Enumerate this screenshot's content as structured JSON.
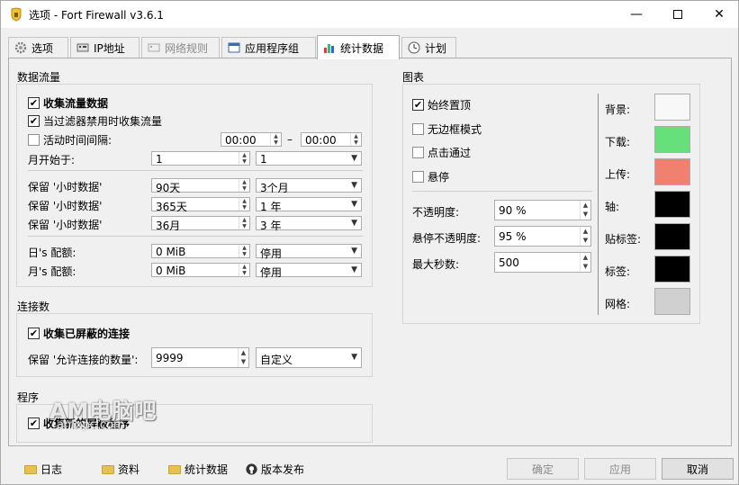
{
  "window": {
    "title": "选项 - Fort Firewall v3.6.1"
  },
  "tabs": [
    {
      "label": "选项",
      "icon": "gear-icon",
      "state": "normal"
    },
    {
      "label": "IP地址",
      "icon": "network-card-icon",
      "state": "normal"
    },
    {
      "label": "网络规则",
      "icon": "network-card-icon",
      "state": "disabled"
    },
    {
      "label": "应用程序组",
      "icon": "window-icon",
      "state": "normal"
    },
    {
      "label": "统计数据",
      "icon": "bar-chart-icon",
      "state": "active"
    },
    {
      "label": "计划",
      "icon": "clock-icon",
      "state": "normal"
    }
  ],
  "traffic": {
    "title": "数据流量",
    "collect": {
      "label": "收集流量数据",
      "checked": true
    },
    "filter_disabled": {
      "label": "当过滤器禁用时收集流量",
      "checked": true
    },
    "active_period": {
      "label": "活动时间间隔:",
      "checked": false,
      "from": "00:00",
      "to": "00:00",
      "dash": "–"
    },
    "month_start": {
      "label": "月开始于:",
      "value": "1",
      "combo": "1"
    },
    "keep_hourly": {
      "label": "保留 '小时数据'",
      "value": "90天",
      "combo": "3个月"
    },
    "keep_daily": {
      "label": "保留 '小时数据'",
      "value": "365天",
      "combo": "1 年"
    },
    "keep_monthly": {
      "label": "保留 '小时数据'",
      "value": "36月",
      "combo": "3 年"
    },
    "day_quota": {
      "label": "日's 配额:",
      "value": "0 MiB",
      "combo": "停用"
    },
    "month_quota": {
      "label": "月's 配额:",
      "value": "0 MiB",
      "combo": "停用"
    }
  },
  "connections": {
    "title": "连接数",
    "collect": {
      "label": "收集已屏蔽的连接",
      "checked": true
    },
    "keep": {
      "label": "保留 '允许连接的数量':",
      "value": "9999",
      "combo": "自定义"
    }
  },
  "programs": {
    "title": "程序",
    "collect": {
      "label": "收集新的屏蔽程序",
      "checked": true
    }
  },
  "graph": {
    "title": "图表",
    "always_on_top": {
      "label": "始终置顶",
      "checked": true
    },
    "frameless": {
      "label": "无边框模式",
      "checked": false
    },
    "click_through": {
      "label": "点击通过",
      "checked": false
    },
    "hover": {
      "label": "悬停",
      "checked": false
    },
    "opacity": {
      "label": "不透明度:",
      "value": "90 %"
    },
    "hover_opacity": {
      "label": "悬停不透明度:",
      "value": "95 %"
    },
    "max_seconds": {
      "label": "最大秒数:",
      "value": "500"
    },
    "colors": [
      {
        "label": "背景:",
        "color": "#f8f8f8"
      },
      {
        "label": "下载:",
        "color": "#66e07a"
      },
      {
        "label": "上传:",
        "color": "#f08070"
      },
      {
        "label": "轴:",
        "color": "#000000"
      },
      {
        "label": "贴标签:",
        "color": "#000000"
      },
      {
        "label": "标签:",
        "color": "#000000"
      },
      {
        "label": "网格:",
        "color": "#d0d0d0"
      }
    ]
  },
  "footer": {
    "links": [
      {
        "label": "日志",
        "icon": "folder-icon"
      },
      {
        "label": "资料",
        "icon": "folder-icon"
      },
      {
        "label": "统计数据",
        "icon": "folder-icon"
      },
      {
        "label": "版本发布",
        "icon": "github-icon"
      }
    ],
    "ok": "确定",
    "apply": "应用",
    "cancel": "取消"
  },
  "watermark": {
    "main": "AM电脑吧",
    "sub": "amxpc.com"
  }
}
